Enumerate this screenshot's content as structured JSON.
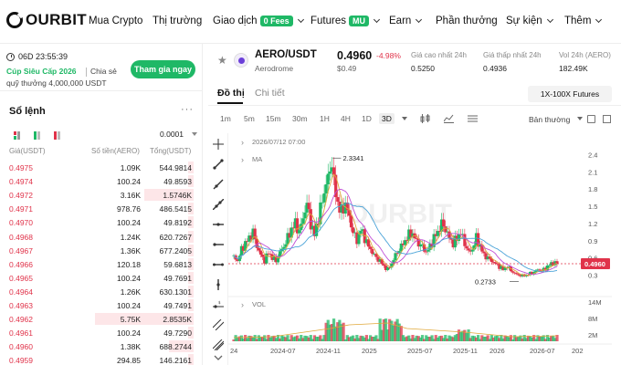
{
  "nav": {
    "logo": "OURBIT",
    "items": [
      {
        "label": "Mua Crypto",
        "x": 97,
        "dropdown": false
      },
      {
        "label": "Thị trường",
        "x": 167,
        "dropdown": false
      },
      {
        "label": "Giao dịch",
        "x": 233,
        "dropdown": true,
        "pill": "0 Fees"
      },
      {
        "label": "Futures",
        "x": 340,
        "dropdown": true,
        "pill": "MU"
      },
      {
        "label": "Earn",
        "x": 426,
        "dropdown": true
      },
      {
        "label": "Phần thưởng",
        "x": 477,
        "dropdown": false
      },
      {
        "label": "Sự kiện",
        "x": 554,
        "dropdown": true
      },
      {
        "label": "Thêm",
        "x": 618,
        "dropdown": true
      }
    ]
  },
  "promo": {
    "timer": "06D 23:55:39",
    "title": "Cúp Siêu Cấp 2026",
    "share": "Chia sẻ",
    "sub": "quỹ thưởng 4,000,000 USDT",
    "join": "Tham gia ngay"
  },
  "orderbook": {
    "title": "Sổ lệnh",
    "more": "···",
    "precision": "0.0001",
    "headers": {
      "price": "Giá(USDT)",
      "amount": "Số tiền(AERO)",
      "total": "Tổng(USDT)"
    },
    "rows": [
      {
        "price": "0.4975",
        "amount": "1.09K",
        "total": "544.9814",
        "depth": 0.05
      },
      {
        "price": "0.4974",
        "amount": "100.24",
        "total": "49.8593",
        "depth": 0.05
      },
      {
        "price": "0.4972",
        "amount": "3.16K",
        "total": "1.5746K",
        "depth": 0.5
      },
      {
        "price": "0.4971",
        "amount": "978.76",
        "total": "486.5415",
        "depth": 0.05
      },
      {
        "price": "0.4970",
        "amount": "100.24",
        "total": "49.8192",
        "depth": 0.05
      },
      {
        "price": "0.4968",
        "amount": "1.24K",
        "total": "620.7267",
        "depth": 0.05
      },
      {
        "price": "0.4967",
        "amount": "1.36K",
        "total": "677.2405",
        "depth": 0.05
      },
      {
        "price": "0.4966",
        "amount": "120.18",
        "total": "59.6813",
        "depth": 0.05
      },
      {
        "price": "0.4965",
        "amount": "100.24",
        "total": "49.7691",
        "depth": 0.05
      },
      {
        "price": "0.4964",
        "amount": "1.26K",
        "total": "630.1301",
        "depth": 0.05
      },
      {
        "price": "0.4963",
        "amount": "100.24",
        "total": "49.7491",
        "depth": 0.05
      },
      {
        "price": "0.4962",
        "amount": "5.75K",
        "total": "2.8535K",
        "depth": 1.0
      },
      {
        "price": "0.4961",
        "amount": "100.24",
        "total": "49.7290",
        "depth": 0.05
      },
      {
        "price": "0.4960",
        "amount": "1.38K",
        "total": "688.2744",
        "depth": 0.25
      },
      {
        "price": "0.4959",
        "amount": "294.85",
        "total": "146.2161",
        "depth": 0.05
      }
    ]
  },
  "ticker": {
    "pair": "AERO/USDT",
    "name": "Aerodrome",
    "price": "0.4960",
    "change": "-4.98%",
    "usd": "$0.49",
    "stats": [
      {
        "label": "Giá cao nhất 24h",
        "value": "0.5250"
      },
      {
        "label": "Giá thấp nhất 24h",
        "value": "0.4936"
      },
      {
        "label": "Vol 24h (AERO)",
        "value": "182.49K"
      }
    ]
  },
  "tabs": {
    "chart": "Đồ thị",
    "detail": "Chi tiết",
    "futures": "1X-100X Futures"
  },
  "timeframes": [
    "1m",
    "5m",
    "15m",
    "30m",
    "1H",
    "4H",
    "1D",
    "3D"
  ],
  "active_tf": "3D",
  "chart_mode": "Bản thường",
  "colors": {
    "brand": "#1fb866",
    "down": "#e0334a",
    "up": "#1fb866"
  },
  "chart_data": {
    "type": "candlestick",
    "header_date": "2026/07/12 07:00",
    "ma_label": "MA",
    "vol_label": "VOL",
    "watermark": "OURBIT",
    "high_label": "2.3341",
    "low_label": "0.2733",
    "last_price": "0.4960",
    "price_axis": [
      "2.4",
      "2.1",
      "1.8",
      "1.5",
      "1.2",
      "0.9",
      "0.6",
      "0.3"
    ],
    "vol_axis": [
      "14M",
      "8M",
      "2M"
    ],
    "x_ticks": [
      "24",
      "2024-07",
      "2024-11",
      "2025",
      "2025-07",
      "2025-11",
      "2026",
      "2026-07",
      "202"
    ],
    "close_path": [
      [
        0,
        0.62
      ],
      [
        4,
        0.55
      ],
      [
        8,
        0.75
      ],
      [
        12,
        0.85
      ],
      [
        16,
        0.95
      ],
      [
        20,
        1.05
      ],
      [
        24,
        0.8
      ],
      [
        28,
        0.65
      ],
      [
        32,
        0.55
      ],
      [
        36,
        0.7
      ],
      [
        40,
        0.6
      ],
      [
        44,
        0.55
      ],
      [
        48,
        0.7
      ],
      [
        52,
        0.8
      ],
      [
        56,
        0.95
      ],
      [
        60,
        1.1
      ],
      [
        64,
        1.2
      ],
      [
        68,
        1.05
      ],
      [
        72,
        1.3
      ],
      [
        76,
        1.55
      ],
      [
        80,
        1.2
      ],
      [
        84,
        1.0
      ],
      [
        88,
        1.3
      ],
      [
        92,
        1.6
      ],
      [
        96,
        1.9
      ],
      [
        100,
        2.1
      ],
      [
        102,
        2.33
      ],
      [
        104,
        1.9
      ],
      [
        108,
        1.55
      ],
      [
        112,
        1.4
      ],
      [
        116,
        1.55
      ],
      [
        120,
        1.3
      ],
      [
        124,
        1.05
      ],
      [
        128,
        0.9
      ],
      [
        132,
        1.1
      ],
      [
        136,
        0.95
      ],
      [
        140,
        0.8
      ],
      [
        144,
        0.7
      ],
      [
        148,
        0.6
      ],
      [
        152,
        0.55
      ],
      [
        156,
        0.45
      ],
      [
        160,
        0.4
      ],
      [
        164,
        0.5
      ],
      [
        168,
        0.65
      ],
      [
        172,
        0.75
      ],
      [
        176,
        0.85
      ],
      [
        180,
        0.95
      ],
      [
        184,
        1.05
      ],
      [
        188,
        0.95
      ],
      [
        192,
        0.85
      ],
      [
        196,
        0.8
      ],
      [
        200,
        0.7
      ],
      [
        204,
        0.8
      ],
      [
        208,
        0.95
      ],
      [
        212,
        1.05
      ],
      [
        216,
        1.2
      ],
      [
        220,
        1.1
      ],
      [
        224,
        0.95
      ],
      [
        228,
        0.85
      ],
      [
        232,
        0.95
      ],
      [
        236,
        1.05
      ],
      [
        240,
        0.85
      ],
      [
        244,
        0.7
      ],
      [
        248,
        0.75
      ],
      [
        252,
        0.95
      ],
      [
        256,
        0.8
      ],
      [
        260,
        0.65
      ],
      [
        264,
        0.6
      ],
      [
        268,
        0.55
      ],
      [
        272,
        0.5
      ],
      [
        276,
        0.45
      ],
      [
        280,
        0.4
      ],
      [
        284,
        0.45
      ],
      [
        288,
        0.38
      ],
      [
        292,
        0.33
      ],
      [
        296,
        0.3
      ],
      [
        300,
        0.29
      ],
      [
        304,
        0.3
      ],
      [
        308,
        0.33
      ],
      [
        312,
        0.35
      ],
      [
        316,
        0.4
      ],
      [
        320,
        0.38
      ],
      [
        324,
        0.42
      ],
      [
        328,
        0.48
      ],
      [
        332,
        0.52
      ],
      [
        336,
        0.5
      ]
    ]
  }
}
